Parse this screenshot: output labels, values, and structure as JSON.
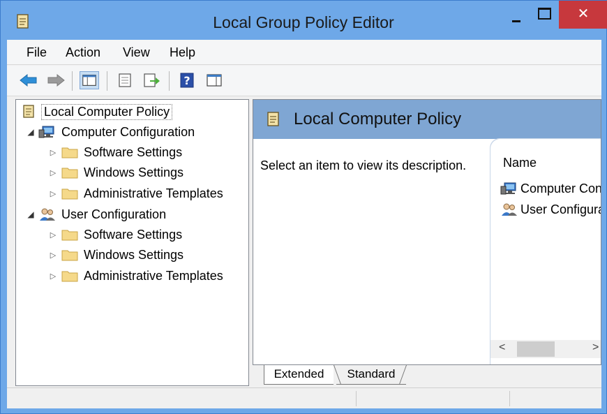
{
  "window": {
    "title": "Local Group Policy Editor",
    "close_label": "✕"
  },
  "menu": {
    "items": [
      "File",
      "Action",
      "View",
      "Help"
    ]
  },
  "toolbar": {
    "icons": [
      "back-arrow-icon",
      "forward-arrow-icon",
      "show-hide-tree-icon",
      "properties-icon",
      "export-list-icon",
      "help-icon",
      "extended-view-icon"
    ]
  },
  "tree": {
    "root": "Local Computer Policy",
    "computer": {
      "label": "Computer Configuration",
      "children": [
        "Software Settings",
        "Windows Settings",
        "Administrative Templates"
      ]
    },
    "user": {
      "label": "User Configuration",
      "children": [
        "Software Settings",
        "Windows Settings",
        "Administrative Templates"
      ]
    }
  },
  "details": {
    "header_title": "Local Computer Policy",
    "description": "Select an item to view its description.",
    "column_name": "Name",
    "items": [
      "Computer Configuration",
      "User Configuration"
    ]
  },
  "tabs": {
    "extended": "Extended",
    "standard": "Standard"
  },
  "scroll": {
    "left_arrow": "<",
    "right_arrow": ">"
  },
  "colors": {
    "titlebar": "#6ea8e8",
    "close": "#c7383d",
    "header": "#7fa6d3"
  }
}
